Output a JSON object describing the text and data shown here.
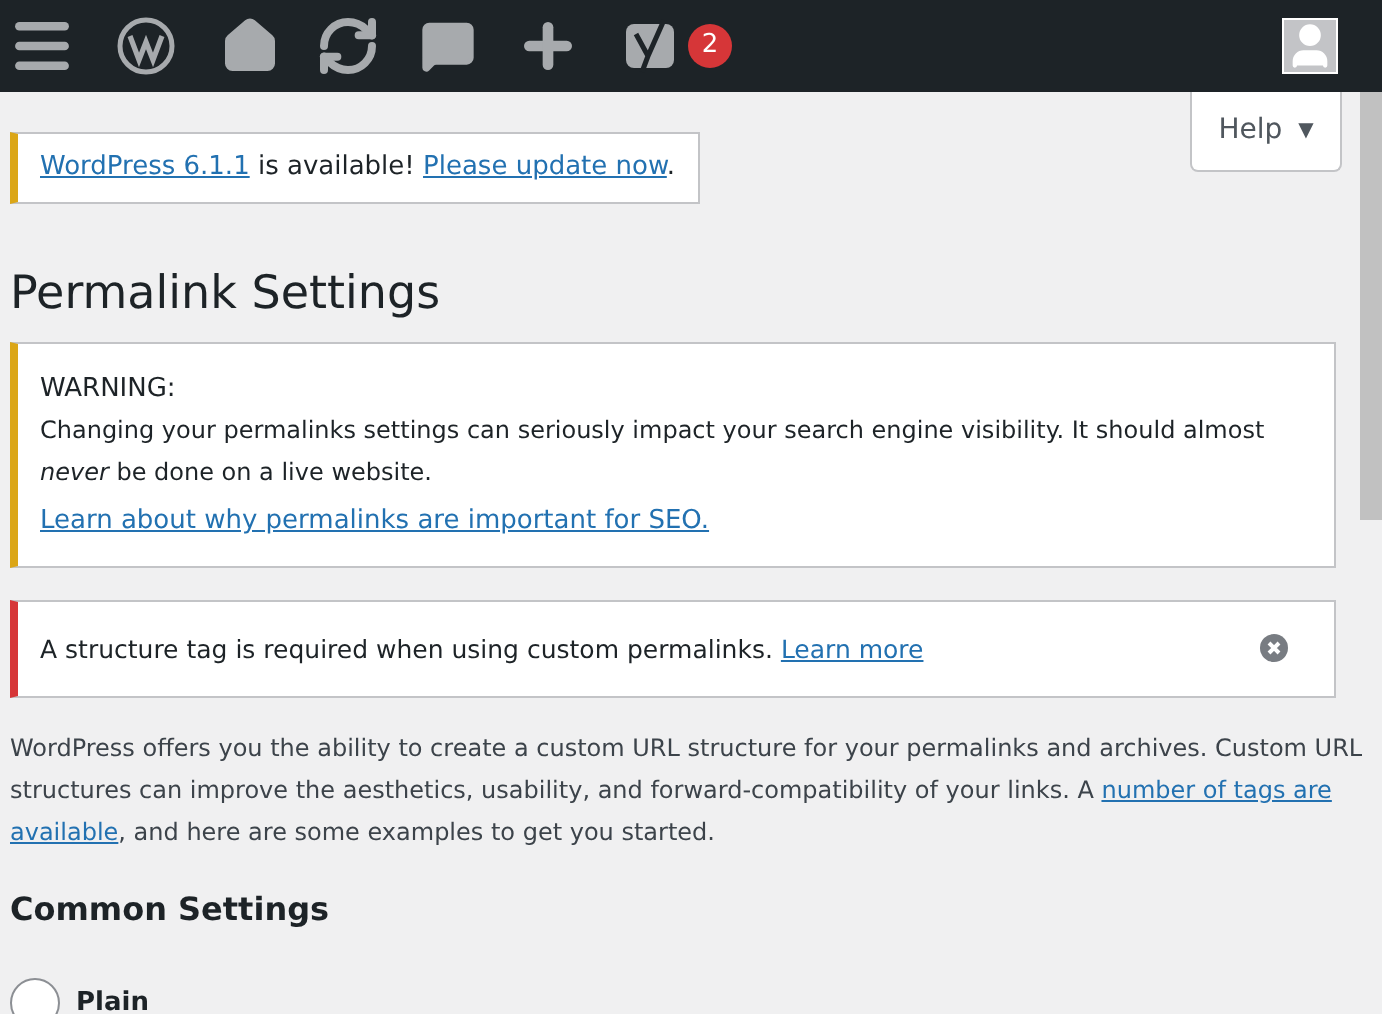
{
  "admin_bar": {
    "badge": "2"
  },
  "help_tab": {
    "label": "Help",
    "caret": "▼"
  },
  "update_notice": {
    "version_link": "WordPress 6.1.1",
    "text": " is available! ",
    "update_link": "Please update now",
    "end": "."
  },
  "title": "Permalink Settings",
  "notices": [
    {
      "kind": "warning",
      "color": "#dba617",
      "heading": "WARNING:",
      "body": "Changing your permalinks settings can seriously impact your search engine visibility. It should almost *never* be done on a live website.",
      "link": "Learn about why permalinks are important for SEO."
    },
    {
      "kind": "error",
      "color": "#d63638",
      "body": "A structure tag is required when using custom permalinks. ",
      "link": "Learn more",
      "dismissible": true
    }
  ],
  "intro": {
    "before": "WordPress offers you the ability to create a custom URL structure for your permalinks and archives. Custom URL structures can improve the aesthetics, usability, and forward-compatibility of your links. A ",
    "links": [
      "number of tags are",
      "available"
    ],
    "after": ", and here are some examples to get you started."
  },
  "section_title": "Common Settings",
  "options": [
    {
      "label": "Plain",
      "selected": false
    }
  ]
}
